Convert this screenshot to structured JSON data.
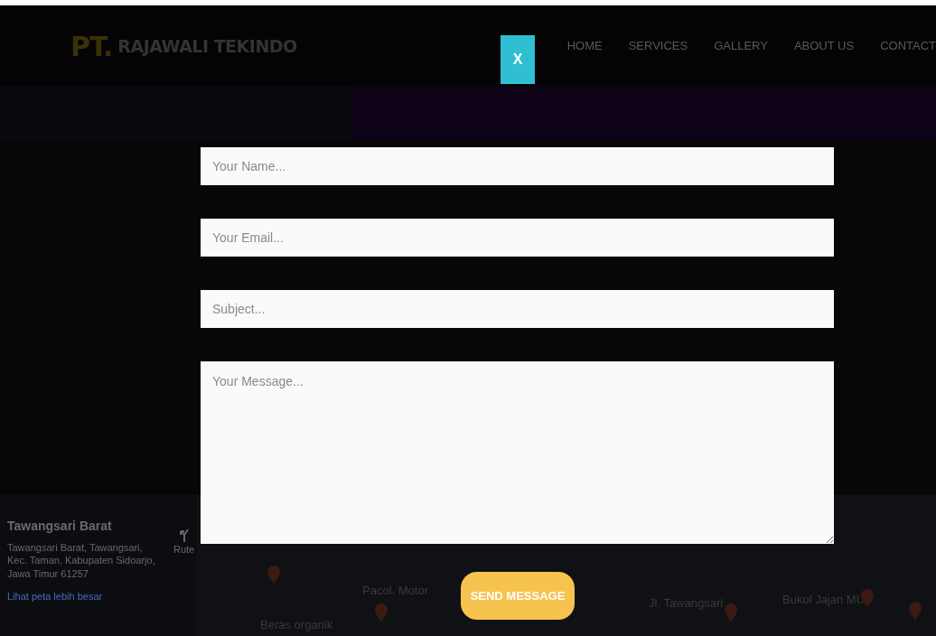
{
  "logo": {
    "prefix": "PT.",
    "name": "RAJAWALI TEKINDO"
  },
  "close_button": "X",
  "nav": [
    {
      "label": "HOME"
    },
    {
      "label": "SERVICES"
    },
    {
      "label": "GALLERY"
    },
    {
      "label": "ABOUT US"
    },
    {
      "label": "CONTACT"
    }
  ],
  "form": {
    "fields": [
      {
        "kind": "input",
        "placeholder": "Your Name..."
      },
      {
        "kind": "input",
        "placeholder": "Your Email..."
      },
      {
        "kind": "input",
        "placeholder": "Subject..."
      },
      {
        "kind": "textarea",
        "placeholder": "Your Message..."
      }
    ],
    "submit": "SEND MESSAGE"
  },
  "map": {
    "place": {
      "title": "Tawangsari Barat",
      "address": "Tawangsari Barat, Tawangsari, Kec. Taman, Kabupaten Sidoarjo, Jawa Timur 61257",
      "directions": "Rute",
      "link": "Lihat peta lebih besar"
    },
    "labels": [
      {
        "text": "Pacol. Motor"
      },
      {
        "text": "Beras organik"
      },
      {
        "text": "Jl. Tawangsari"
      },
      {
        "text": "Bukol Jajan MU"
      }
    ]
  }
}
